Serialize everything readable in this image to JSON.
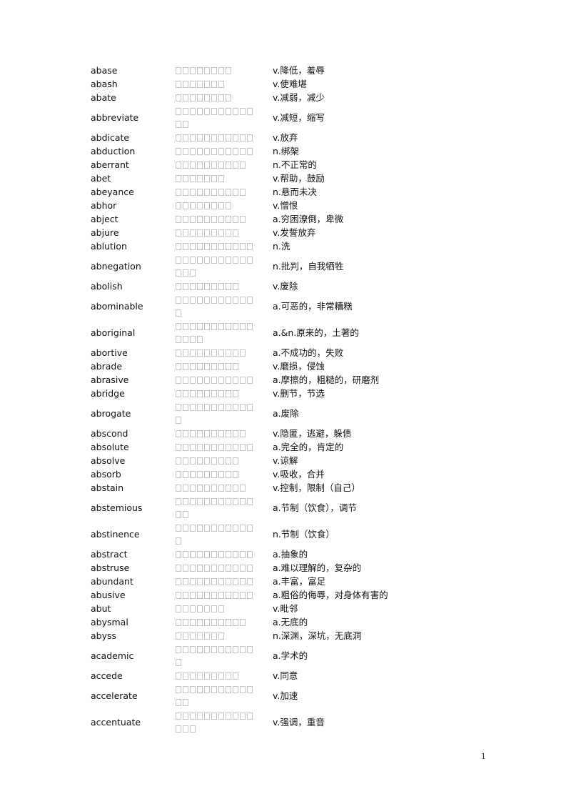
{
  "page_number": "1",
  "entries": [
    {
      "word": "abase",
      "tofu": [
        8
      ],
      "definition": "v.降低，羞辱"
    },
    {
      "word": "abash",
      "tofu": [
        7
      ],
      "definition": "v.使难堪"
    },
    {
      "word": "abate",
      "tofu": [
        8
      ],
      "definition": "v.减弱，减少"
    },
    {
      "word": "abbreviate",
      "tofu": [
        11,
        2
      ],
      "definition": "v.减短，缩写"
    },
    {
      "word": "abdicate",
      "tofu": [
        11
      ],
      "definition": "v.放弃"
    },
    {
      "word": "abduction",
      "tofu": [
        11
      ],
      "definition": "n.绑架"
    },
    {
      "word": "aberrant",
      "tofu": [
        10
      ],
      "definition": "n.不正常的"
    },
    {
      "word": "abet",
      "tofu": [
        7
      ],
      "definition": "v.帮助，鼓励"
    },
    {
      "word": "abeyance",
      "tofu": [
        10
      ],
      "definition": "n.悬而未决"
    },
    {
      "word": "abhor",
      "tofu": [
        8
      ],
      "definition": "v.憎恨"
    },
    {
      "word": "abject",
      "tofu": [
        10
      ],
      "definition": "a.穷困潦倒，卑微"
    },
    {
      "word": "abjure",
      "tofu": [
        9
      ],
      "definition": "v.发誓放弃"
    },
    {
      "word": "ablution",
      "tofu": [
        11
      ],
      "definition": "n.洗"
    },
    {
      "word": "abnegation",
      "tofu": [
        11,
        3
      ],
      "definition": "n.批判，自我牺牲"
    },
    {
      "word": "abolish",
      "tofu": [
        9
      ],
      "definition": "v.废除"
    },
    {
      "word": "abominable",
      "tofu": [
        11,
        1
      ],
      "definition": "a.可恶的，非常糟糕"
    },
    {
      "word": "aboriginal",
      "tofu": [
        11,
        4
      ],
      "definition": "a.&n.原来的，土著的"
    },
    {
      "word": "abortive",
      "tofu": [
        10
      ],
      "definition": "a.不成功的，失败"
    },
    {
      "word": "abrade",
      "tofu": [
        9
      ],
      "definition": "v.磨损，侵蚀"
    },
    {
      "word": "abrasive",
      "tofu": [
        11
      ],
      "definition": "a.摩擦的，粗糙的，研磨剂"
    },
    {
      "word": "abridge",
      "tofu": [
        9
      ],
      "definition": "v.删节，节选"
    },
    {
      "word": "abrogate",
      "tofu": [
        11,
        1
      ],
      "definition": "a.废除"
    },
    {
      "word": "abscond",
      "tofu": [
        10
      ],
      "definition": "v.隐匿，逃避，躲债"
    },
    {
      "word": "absolute",
      "tofu": [
        11
      ],
      "definition": "a.完全的，肯定的"
    },
    {
      "word": "absolve",
      "tofu": [
        9
      ],
      "definition": "v.谅解"
    },
    {
      "word": "absorb",
      "tofu": [
        9
      ],
      "definition": "v.吸收，合并"
    },
    {
      "word": "abstain",
      "tofu": [
        10
      ],
      "definition": "v.控制，限制（自己）"
    },
    {
      "word": "abstemious",
      "tofu": [
        11,
        2
      ],
      "definition": "a.节制（饮食），调节"
    },
    {
      "word": "abstinence",
      "tofu": [
        11,
        1
      ],
      "definition": "n.节制（饮食）"
    },
    {
      "word": "abstract",
      "tofu": [
        11
      ],
      "definition": "a.抽象的"
    },
    {
      "word": "abstruse",
      "tofu": [
        11
      ],
      "definition": "a.难以理解的，复杂的"
    },
    {
      "word": "abundant",
      "tofu": [
        11
      ],
      "definition": "a.丰富，富足"
    },
    {
      "word": "abusive",
      "tofu": [
        11
      ],
      "definition": "a.粗俗的侮辱，对身体有害的"
    },
    {
      "word": "abut",
      "tofu": [
        7
      ],
      "definition": "v.毗邻"
    },
    {
      "word": "abysmal",
      "tofu": [
        10
      ],
      "definition": "a.无底的"
    },
    {
      "word": "abyss",
      "tofu": [
        7
      ],
      "definition": "n.深渊，深坑，无底洞"
    },
    {
      "word": "academic",
      "tofu": [
        11,
        1
      ],
      "definition": "a.学术的"
    },
    {
      "word": "accede",
      "tofu": [
        9
      ],
      "definition": "v.同意"
    },
    {
      "word": "accelerate",
      "tofu": [
        11,
        2
      ],
      "definition": "v.加速"
    },
    {
      "word": "accentuate",
      "tofu": [
        11,
        3
      ],
      "definition": "v.强调，重音"
    }
  ]
}
